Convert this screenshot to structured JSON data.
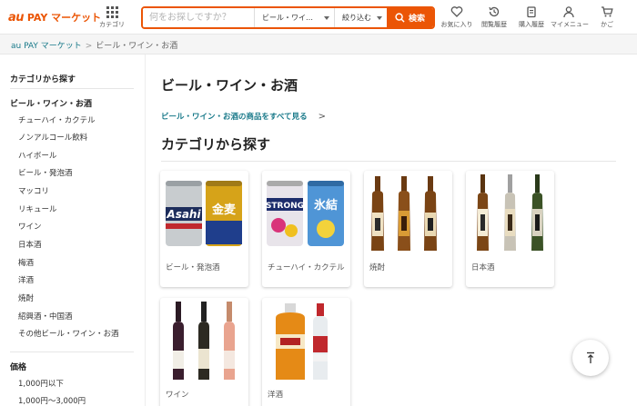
{
  "header": {
    "logo_au": "au",
    "logo_text": "PAY マーケット",
    "category_label": "カテゴリ",
    "search": {
      "placeholder": "何をお探しですか？",
      "scope": "ビール・ワイ…",
      "filter": "絞り込む",
      "button": "検索"
    },
    "nav": [
      {
        "label": "お気に入り",
        "icon": "heart-icon"
      },
      {
        "label": "閲覧履歴",
        "icon": "history-icon"
      },
      {
        "label": "購入履歴",
        "icon": "receipt-icon"
      },
      {
        "label": "マイメニュー",
        "icon": "user-icon"
      },
      {
        "label": "かご",
        "icon": "cart-icon"
      }
    ]
  },
  "breadcrumb": {
    "home": "au PAY マーケット",
    "separator": ">",
    "current": "ビール・ワイン・お酒"
  },
  "sidebar": {
    "heading": "カテゴリから探す",
    "parent": "ビール・ワイン・お酒",
    "items": [
      "チューハイ・カクテル",
      "ノンアルコール飲料",
      "ハイボール",
      "ビール・発泡酒",
      "マッコリ",
      "リキュール",
      "ワイン",
      "日本酒",
      "梅酒",
      "洋酒",
      "焼酎",
      "紹興酒・中国酒",
      "その他ビール・ワイン・お酒"
    ],
    "price_heading": "価格",
    "price_items": [
      "1,000円以下",
      "1,000円〜3,000円"
    ]
  },
  "main": {
    "title": "ビール・ワイン・お酒",
    "all_link": "ビール・ワイン・お酒の商品をすべて見る",
    "all_link_arrow": ">",
    "section_title": "カテゴリから探す",
    "cards": [
      {
        "name": "ビール・発泡酒"
      },
      {
        "name": "チューハイ・カクテル"
      },
      {
        "name": "焼酎"
      },
      {
        "name": "日本酒"
      },
      {
        "name": "ワイン"
      },
      {
        "name": "洋酒"
      }
    ],
    "product_labels": {
      "beer_asahi": "Asahi",
      "beer_kinmugi": "金麦",
      "chuhai_strong": "STRONG",
      "chuhai_hyoketsu": "氷結"
    }
  },
  "colors": {
    "accent": "#eb5505",
    "link": "#1a7a8a"
  }
}
